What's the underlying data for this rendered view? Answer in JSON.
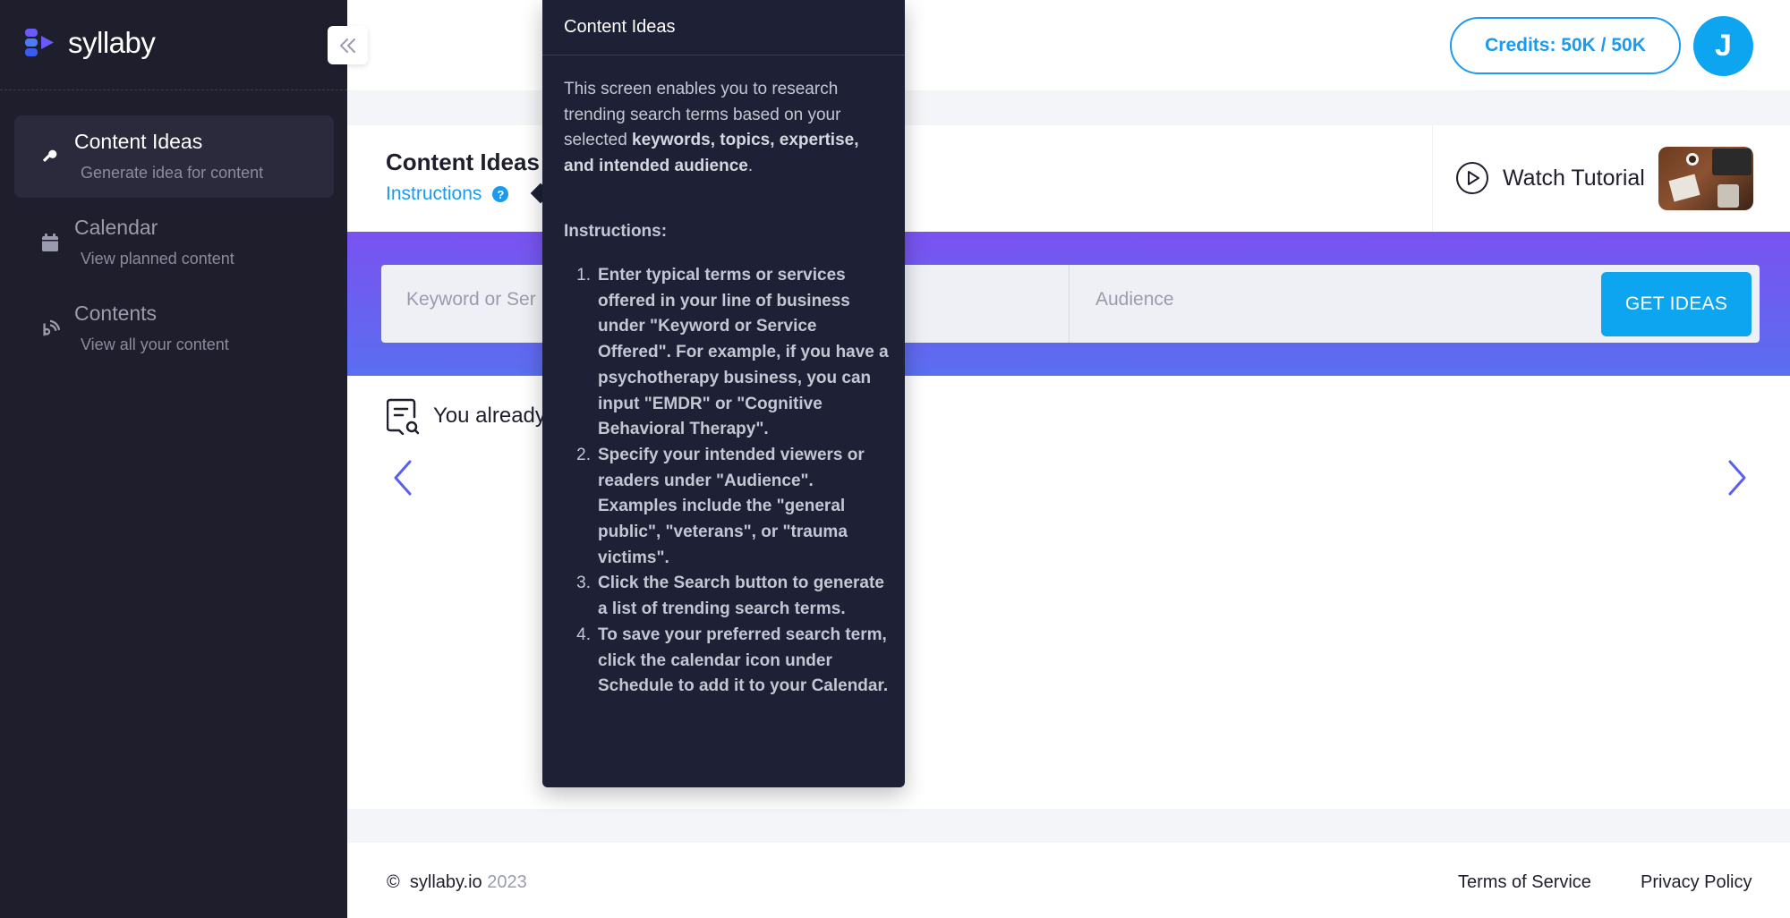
{
  "brand": {
    "name": "syllaby"
  },
  "sidebar": {
    "items": [
      {
        "label": "Content Ideas",
        "sub": "Generate idea for content",
        "icon": "key-icon"
      },
      {
        "label": "Calendar",
        "sub": "View planned content",
        "icon": "calendar-icon"
      },
      {
        "label": "Contents",
        "sub": "View all your content",
        "icon": "broadcast-icon"
      }
    ]
  },
  "header": {
    "credits": "Credits: 50K / 50K",
    "avatar": "J"
  },
  "page": {
    "title": "Content Ideas",
    "instructions_link": "Instructions",
    "help_symbol": "?",
    "watch_tutorial": "Watch Tutorial"
  },
  "search": {
    "keyword_placeholder": "Keyword or Ser",
    "audience_placeholder": "Audience",
    "button": "GET IDEAS"
  },
  "already": {
    "text": "You already"
  },
  "footer": {
    "copyright_symbol": "©",
    "site": "syllaby.io",
    "year": "2023",
    "terms": "Terms of Service",
    "privacy": "Privacy Policy"
  },
  "popover": {
    "title": "Content Ideas",
    "intro_plain": "This screen enables you to research trending search terms based on your selected ",
    "intro_bold": "keywords, topics, expertise, and intended audience",
    "intro_end": ".",
    "instructions_heading": "Instructions:",
    "steps": [
      {
        "num": "1.",
        "text": "Enter typical terms or services offered in your line of business under \"Keyword or Service Offered\". For example, if you have a psychotherapy business, you can input \"EMDR\" or \"Cognitive Behavioral Therapy\"."
      },
      {
        "num": "2.",
        "text": "Specify your intended viewers or readers under \"Audience\". Examples include the \"general public\", \"veterans\", or \"trauma victims\"."
      },
      {
        "num": "3.",
        "text": "Click the Search button to generate a list of trending search terms."
      },
      {
        "num": "4.",
        "text": "To save your preferred search term, click the calendar icon under Schedule to add it to your Calendar."
      }
    ]
  },
  "colors": {
    "sidebar": "#1e1e2d",
    "accent_blue": "#0ea5f0",
    "banner_start": "#7a52f0",
    "banner_end": "#5a6ef0",
    "popover": "#1e2035"
  }
}
